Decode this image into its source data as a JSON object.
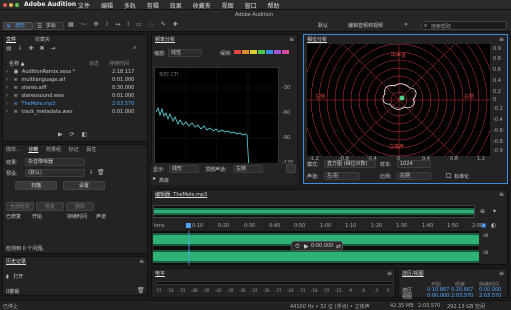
{
  "app": {
    "name": "Adobe Audition",
    "window_title": "Adobe Audition",
    "menu": [
      "文件",
      "编辑",
      "多轨",
      "剪辑",
      "效果",
      "收藏夹",
      "视图",
      "窗口",
      "帮助"
    ]
  },
  "toolbar": {
    "waveform_label": "波形",
    "multitrack_label": "多轨",
    "workspace_default": "默认",
    "workspace_edit_video": "编辑音频到视频",
    "search_placeholder": "搜索帮助"
  },
  "files_panel": {
    "title": "文件",
    "tab2": "收藏夹",
    "col_status": "状态",
    "col_duration": "持续时间",
    "items": [
      {
        "name": "AuditionRemix.sesx *",
        "duration": "2:18.117"
      },
      {
        "name": "multilanguage.aif",
        "duration": "0:01.000"
      },
      {
        "name": "stereo.aiff",
        "duration": "0:30.000"
      },
      {
        "name": "stereosound.wav",
        "duration": "0:01.000"
      },
      {
        "name": "TheMole.mp3",
        "duration": "2:03.570"
      },
      {
        "name": "track_metadata.wav",
        "duration": "0:01.000"
      }
    ]
  },
  "effects_panel": {
    "tabs": [
      "媒体...",
      "诊断",
      "效果组",
      "标记",
      "属性"
    ],
    "effect_label": "效果:",
    "effect_value": "杂音降噪器",
    "preset_label": "预设:",
    "preset_value": "(默认)",
    "scan_button": "扫描",
    "settings_button": "设置",
    "header_cols": [
      "已修复",
      "开始",
      "持续时间",
      "声道"
    ],
    "repair_all": "全部修复",
    "repair": "修复",
    "delete": "删除",
    "status_text": "检测到 0 个问题。"
  },
  "history_panel": {
    "title": "历史记录",
    "item": "打开",
    "undo_label": "0撤销"
  },
  "footer": {
    "status": "已停止",
    "sample_rate": "44100 Hz • 32 位 (浮点) • 立体声",
    "size1": "42.35 MB",
    "duration": "2:03.570",
    "free": "292.13 GB 空闲"
  },
  "spectrum_panel": {
    "title": "频率分析",
    "scale_label": "缩放:",
    "scale_value": "线性",
    "hold_label": "保持:",
    "readout": "实时 CTI",
    "y_labels": [
      "-30",
      "-60",
      "-90",
      "-120"
    ],
    "x_labels": [
      "5k",
      "10k",
      "15k",
      "20k"
    ],
    "display_label": "显示:",
    "display_value": "线形",
    "channel_label": "顶部声道:",
    "channel_value": "左侧",
    "advanced": "高级"
  },
  "phase_panel": {
    "title": "相位分析",
    "left_label": "左侧",
    "right_label": "右侧",
    "top_label": "中声道",
    "bottom_label": "立体声",
    "y_ticks": [
      "0.9",
      "0.8",
      "0.6",
      "0.4",
      "0.2",
      "0",
      "-0.2",
      "-0.4",
      "-0.6",
      "-0.8",
      "-0.9"
    ],
    "x_ticks": [
      "-1.2",
      "-0.8",
      "-0.4",
      "0",
      "0.4",
      "0.8",
      "1.2"
    ],
    "mode_label": "模式:",
    "mode_value": "直方图 (相位对数)",
    "samples_label": "样本:",
    "samples_value": "1024",
    "channel_label": "声道:",
    "channel_value": "左/右",
    "ratio_label": "比例:",
    "ratio_value": "右侧",
    "normalize_label": "标准化"
  },
  "editor_panel": {
    "title": "编辑器: TheMole.mp3",
    "hms_label": "hms",
    "time_ticks": [
      "0:10",
      "0:20",
      "0:30",
      "0:40",
      "0:50",
      "1:00",
      "1:10",
      "1:20",
      "1:30",
      "1:40",
      "1:50",
      "2:00"
    ],
    "current_time": "0:00.000",
    "playhead_time": "0:00.000",
    "db_label": "dB"
  },
  "level_panel": {
    "title": "电平",
    "ticks": [
      "-57",
      "-54",
      "-51",
      "-48",
      "-45",
      "-42",
      "-39",
      "-36",
      "-33",
      "-30",
      "-27",
      "-24",
      "-21",
      "-18",
      "-15",
      "-12",
      "-9",
      "-6",
      "-3",
      "0"
    ]
  },
  "selection_panel": {
    "title": "选区/视图",
    "col_start": "开始",
    "col_end": "结束",
    "col_duration": "持续时间",
    "row1_label": "选区",
    "row1": [
      "0:10.667",
      "0:10.667",
      "0:00.000"
    ],
    "row2_label": "视图",
    "row2": [
      "0:00.000",
      "2:03.570",
      "2:03.570"
    ]
  },
  "colors": {
    "accent": "#4fa3ff",
    "waveform": "#2fcf86",
    "spectrum": "#5ed7e0",
    "phase_grid": "#d23a3a",
    "phase_highlight": "#3aa0ff"
  }
}
